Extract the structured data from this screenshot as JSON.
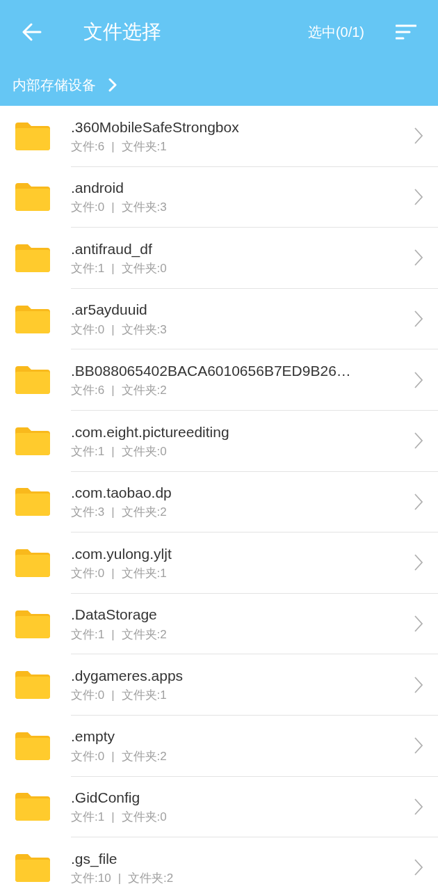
{
  "header": {
    "title": "文件选择",
    "selection": "选中(0/1)"
  },
  "breadcrumb": [
    {
      "label": "内部存储设备"
    }
  ],
  "folders": [
    {
      "name": ".360MobileSafeStrongbox",
      "files": "文件:6",
      "separator": "|",
      "subfolders": "文件夹:1"
    },
    {
      "name": ".android",
      "files": "文件:0",
      "separator": "|",
      "subfolders": "文件夹:3"
    },
    {
      "name": ".antifraud_df",
      "files": "文件:1",
      "separator": "|",
      "subfolders": "文件夹:0"
    },
    {
      "name": ".ar5ayduuid",
      "files": "文件:0",
      "separator": "|",
      "subfolders": "文件夹:3"
    },
    {
      "name": ".BB088065402BACA6010656B7ED9B26…",
      "files": "文件:6",
      "separator": "|",
      "subfolders": "文件夹:2"
    },
    {
      "name": ".com.eight.pictureediting",
      "files": "文件:1",
      "separator": "|",
      "subfolders": "文件夹:0"
    },
    {
      "name": ".com.taobao.dp",
      "files": "文件:3",
      "separator": "|",
      "subfolders": "文件夹:2"
    },
    {
      "name": ".com.yulong.yljt",
      "files": "文件:0",
      "separator": "|",
      "subfolders": "文件夹:1"
    },
    {
      "name": ".DataStorage",
      "files": "文件:1",
      "separator": "|",
      "subfolders": "文件夹:2"
    },
    {
      "name": ".dygameres.apps",
      "files": "文件:0",
      "separator": "|",
      "subfolders": "文件夹:1"
    },
    {
      "name": ".empty",
      "files": "文件:0",
      "separator": "|",
      "subfolders": "文件夹:2"
    },
    {
      "name": ".GidConfig",
      "files": "文件:1",
      "separator": "|",
      "subfolders": "文件夹:0"
    },
    {
      "name": ".gs_file",
      "files": "文件:10",
      "separator": "|",
      "subfolders": "文件夹:2"
    }
  ]
}
